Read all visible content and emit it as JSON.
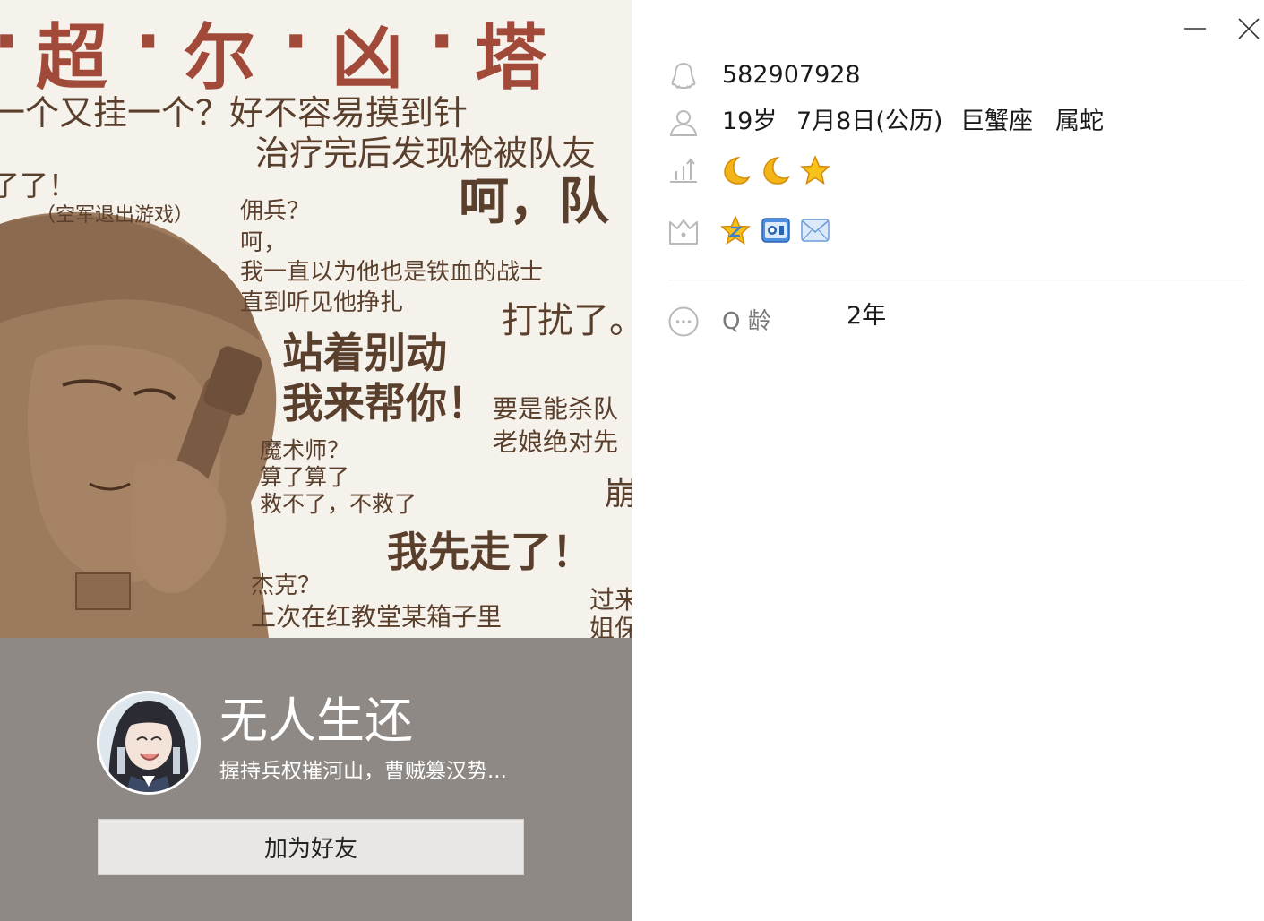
{
  "window": {
    "minimize_glyph": "—",
    "close_glyph": "✕"
  },
  "cover": {
    "title_chars": [
      "超",
      "尔",
      "凶",
      "塔"
    ],
    "dots": [
      "·",
      "·",
      "·",
      "·"
    ],
    "lines": [
      "一个又挂一个？好不容易摸到针",
      "治疗完后发现枪被队友",
      "了了！",
      "（空军退出游戏）",
      "佣兵？",
      "呵，",
      "我一直以为他也是铁血的战士",
      "直到听见他挣扎",
      "呵，队",
      "打扰了。",
      "站着别动",
      "我来帮你！",
      "要是能杀队",
      "老娘绝对先",
      "魔术师？",
      "算了算了",
      "救不了，不救了",
      "崩",
      "我先走了！",
      "杰克？",
      "上次在红教堂某箱子里",
      "过来",
      "姐保"
    ]
  },
  "profile": {
    "nickname": "无人生还",
    "signature": "握持兵权摧河山，曹贼篡汉势...",
    "add_friend_label": "加为好友"
  },
  "info": {
    "qq_number": "582907928",
    "age": "19岁",
    "birthday": "7月8日(公历)",
    "zodiac": "巨蟹座",
    "chinese_zodiac": "属蛇",
    "level_icons": [
      "moon-icon",
      "moon-icon",
      "star-icon"
    ],
    "badge_icons": [
      "qzone-star-icon",
      "qq-show-icon",
      "mail-icon"
    ],
    "qage_label": "Q 龄",
    "qage_value": "2年"
  },
  "colors": {
    "bottom_panel": "#8f8985",
    "icon_gray": "#b8b8b8",
    "button_bg": "#e9e7e5",
    "cover_text_red": "#a24a3a",
    "cover_text_brown": "#5a3f2c"
  }
}
